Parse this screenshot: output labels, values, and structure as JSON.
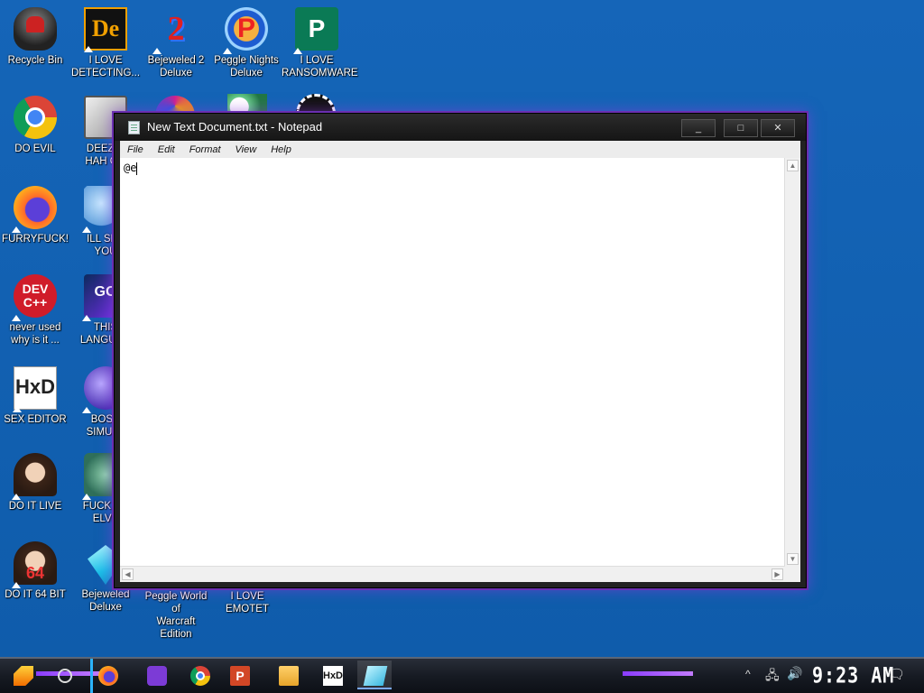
{
  "desktop": {
    "icons": [
      {
        "label_lines": [
          "Recycle Bin"
        ]
      },
      {
        "label_lines": [
          "I LOVE",
          "DETECTING..."
        ]
      },
      {
        "label_lines": [
          "Bejeweled 2",
          "Deluxe"
        ]
      },
      {
        "label_lines": [
          "Peggle Nights",
          "Deluxe"
        ]
      },
      {
        "label_lines": [
          "I LOVE",
          "RANSOMWARE"
        ]
      },
      {
        "label_lines": [
          "DO EVIL"
        ]
      },
      {
        "label_lines": [
          "DEEZ N",
          "HAH GO"
        ]
      },
      {
        "label_lines": [
          "FURRYFUCK!"
        ]
      },
      {
        "label_lines": [
          "ILL SPY",
          "YOU"
        ]
      },
      {
        "label_lines": [
          "never used",
          "why is it ..."
        ],
        "badge": "DEV C++"
      },
      {
        "label_lines": [
          "THIS",
          "LANGUAG"
        ],
        "badge": "GO"
      },
      {
        "label_lines": [
          "SEX EDITOR"
        ],
        "badge": "HxD"
      },
      {
        "label_lines": [
          "BOSN",
          "SIMULA"
        ]
      },
      {
        "label_lines": [
          "DO IT LIVE"
        ]
      },
      {
        "label_lines": [
          "FUCK SC",
          "ELVE"
        ]
      },
      {
        "label_lines": [
          "DO IT 64 BIT"
        ],
        "badge": "64"
      },
      {
        "label_lines": [
          "Bejeweled",
          "Deluxe"
        ]
      },
      {
        "label_lines": [
          "Peggle World of",
          "Warcraft Edition"
        ]
      },
      {
        "label_lines": [
          "I LOVE EMOTET"
        ]
      }
    ]
  },
  "notepad": {
    "title": "New Text Document.txt - Notepad",
    "buttons": {
      "minimize": "_",
      "maximize": "□",
      "close": "✕"
    },
    "menu": [
      "File",
      "Edit",
      "Format",
      "View",
      "Help"
    ],
    "content": "@e",
    "scroll_arrows": {
      "up": "▲",
      "down": "▼",
      "left": "◀",
      "right": "▶"
    }
  },
  "taskbar": {
    "ppt_letter": "P",
    "hxd_label": "HxD",
    "clock": "9:23 AM",
    "tray_chevron": "^",
    "tray_network": "🖧",
    "tray_volume": "🔊",
    "tray_notifications": "🗨"
  },
  "colors": {
    "desktop_bg": "#1260b0",
    "window_glow": "#8a3cff",
    "taskbar_bg": "#161a22"
  }
}
